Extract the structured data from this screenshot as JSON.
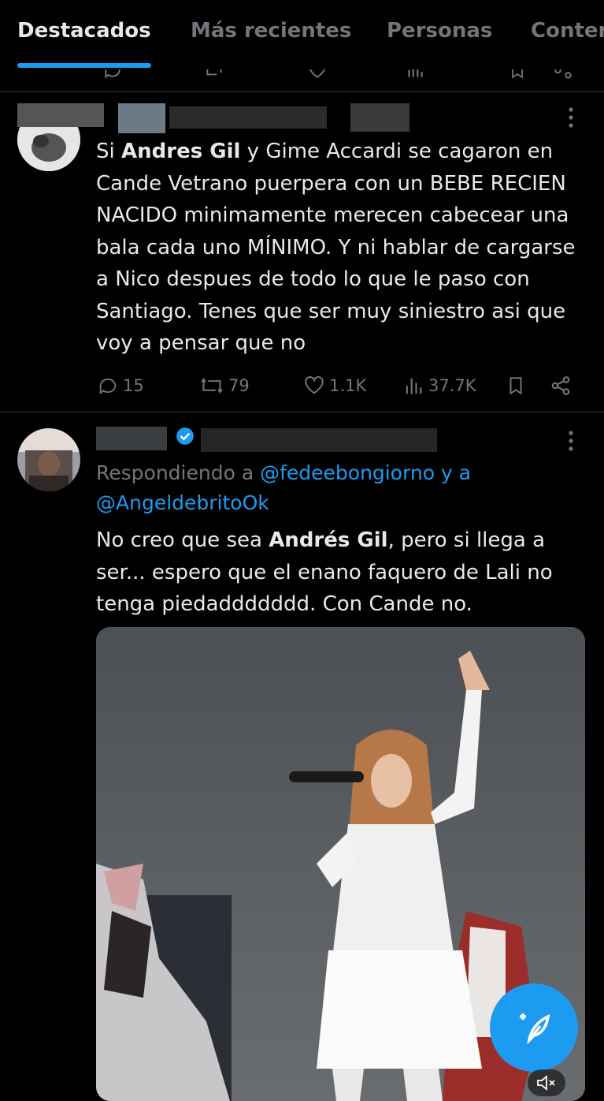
{
  "tabs": [
    {
      "label": "Destacados",
      "active": true
    },
    {
      "label": "Más recientes",
      "active": false
    },
    {
      "label": "Personas",
      "active": false
    },
    {
      "label": "Conter",
      "active": false
    }
  ],
  "tweet1": {
    "text_html": "Si <b>Andres Gil</b> y Gime Accardi se cagaron en Cande Vetrano puerpera con un BEBE RECIEN NACIDO minimamente merecen cabecear una bala cada uno MÍNIMO. Y ni hablar de cargarse a Nico despues de todo lo que le paso con Santiago. Tenes que ser muy siniestro asi que voy a pensar que no",
    "stats": {
      "replies": "15",
      "reposts": "79",
      "likes": "1.1K",
      "views": "37.7K"
    }
  },
  "tweet2": {
    "reply_prefix": "Respondiendo a",
    "reply_handle_1": "@fedeebongiorno",
    "reply_joiner": "y a",
    "reply_handle_2": "@AngeldebritoOk",
    "text_before": "No creo que sea ",
    "text_bold": "Andrés Gil",
    "text_after": ", pero si llega a ser... espero que el enano faquero de Lali no tenga piedaddddddd. Con Cande no."
  },
  "colors": {
    "accent": "#1d9bf0",
    "muted": "#71767b",
    "text": "#e7e9ea",
    "divider": "#2f3336"
  },
  "icons": [
    "reply-icon",
    "repost-icon",
    "like-icon",
    "views-icon",
    "bookmark-icon",
    "share-icon",
    "more-icon",
    "verified-icon",
    "compose-icon",
    "mute-icon"
  ]
}
